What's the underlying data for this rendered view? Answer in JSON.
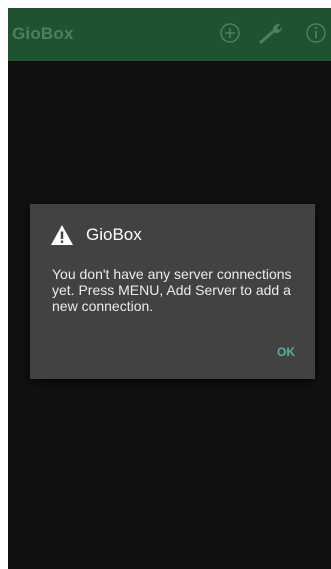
{
  "app_bar": {
    "title": "GioBox",
    "background_color": "#1f5230",
    "icons": [
      "add-circle-icon",
      "wrench-icon",
      "info-icon"
    ]
  },
  "dialog": {
    "icon": "warning-icon",
    "title": "GioBox",
    "message": "You don't have any server connections yet. Press MENU, Add Server to add a new connection.",
    "ok_label": "OK",
    "accent_color": "#54b0a7",
    "background_color": "#424242"
  }
}
